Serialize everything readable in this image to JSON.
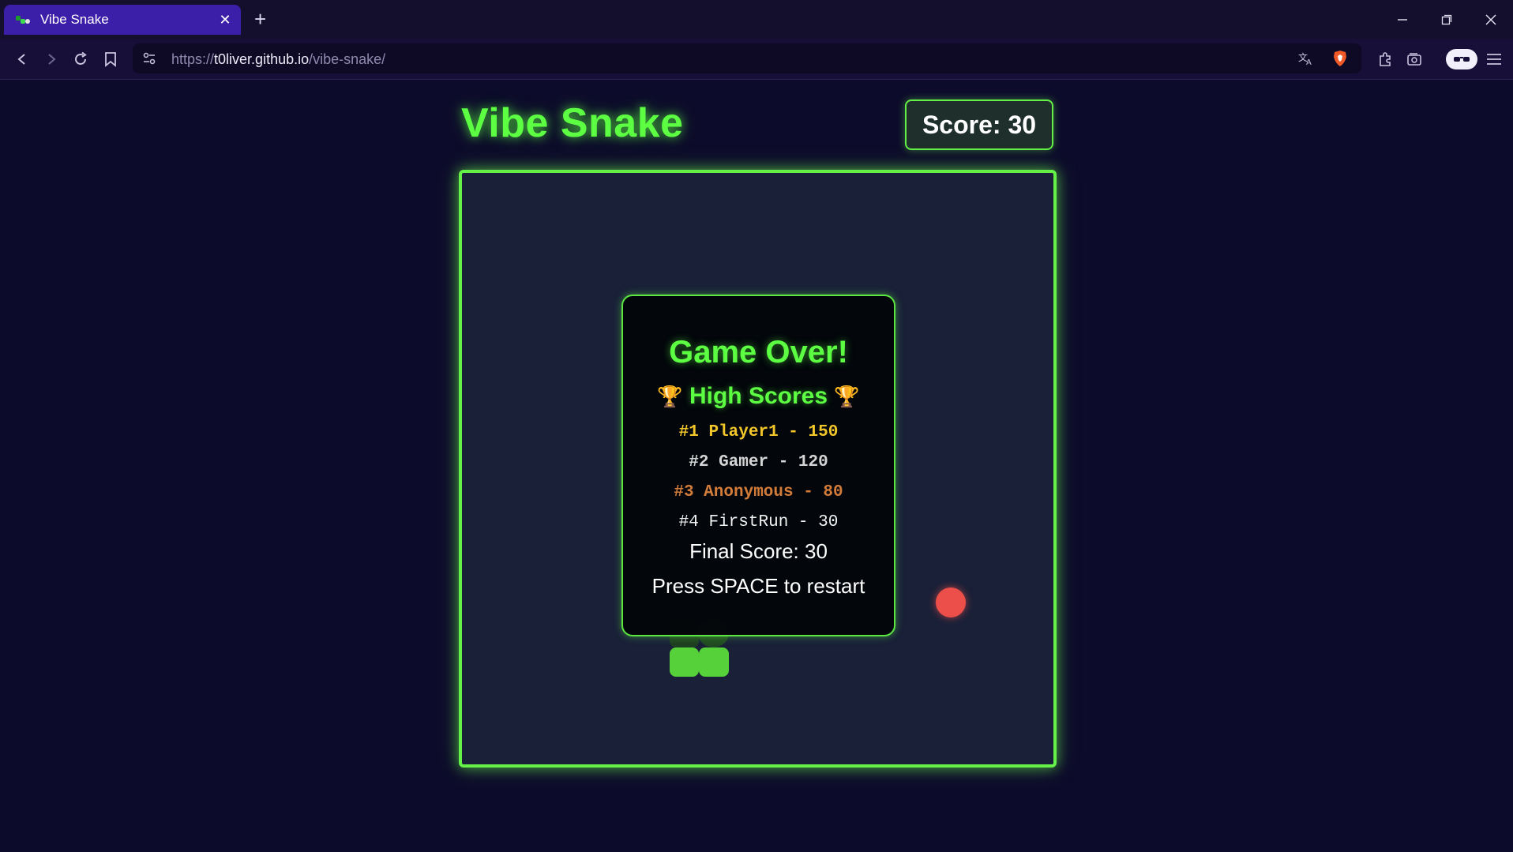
{
  "browser": {
    "tab_title": "Vibe Snake",
    "tab_close": "✕",
    "new_tab": "+",
    "url_scheme": "https://",
    "url_host": "t0liver.github.io",
    "url_path": "/vibe-snake/"
  },
  "game": {
    "title": "Vibe Snake",
    "score_text": "Score: 30",
    "food_color": "#ec4e49",
    "snake_color": "#56d13a"
  },
  "overlay": {
    "title": "Game Over!",
    "trophy": "🏆",
    "high_scores_title": "High Scores",
    "high_scores": [
      "#1 Player1 - 150",
      "#2 Gamer - 120",
      "#3 Anonymous - 80",
      "#4 FirstRun - 30"
    ],
    "final_score": "Final Score: 30",
    "restart_hint": "Press SPACE to restart"
  }
}
